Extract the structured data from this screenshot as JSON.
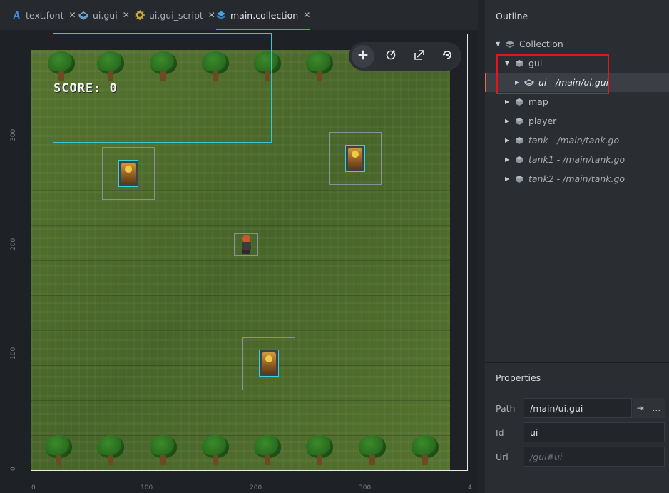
{
  "tabs": [
    {
      "label": "text.font",
      "icon": "font-icon",
      "active": false
    },
    {
      "label": "ui.gui",
      "icon": "gui-icon",
      "active": false
    },
    {
      "label": "ui.gui_script",
      "icon": "script-gear-icon",
      "active": false
    },
    {
      "label": "main.collection",
      "icon": "collection-icon",
      "active": true
    }
  ],
  "tab_close_glyph": "✕",
  "scene": {
    "score_text": "SCORE: 0",
    "ruler_vertical": [
      "300",
      "200",
      "100",
      "0"
    ],
    "ruler_horizontal": [
      "0",
      "100",
      "200",
      "300",
      "4"
    ]
  },
  "toolbar": {
    "tools": [
      "move-tool-icon",
      "rotate-tool-icon",
      "scale-tool-icon",
      "camera-reset-icon"
    ]
  },
  "outline": {
    "title": "Outline",
    "root": "Collection",
    "items": [
      {
        "label": "gui",
        "indent": 1,
        "expanded": true,
        "italic": false
      },
      {
        "label": "ui - /main/ui.gui",
        "indent": 2,
        "expanded": false,
        "italic": true,
        "selected": true
      },
      {
        "label": "map",
        "indent": 1,
        "expanded": false,
        "italic": false
      },
      {
        "label": "player",
        "indent": 1,
        "expanded": false,
        "italic": false
      },
      {
        "label": "tank - /main/tank.go",
        "indent": 1,
        "expanded": false,
        "italic": true
      },
      {
        "label": "tank1 - /main/tank.go",
        "indent": 1,
        "expanded": false,
        "italic": true
      },
      {
        "label": "tank2 - /main/tank.go",
        "indent": 1,
        "expanded": false,
        "italic": true
      }
    ]
  },
  "properties": {
    "title": "Properties",
    "path_label": "Path",
    "path_value": "/main/ui.gui",
    "path_goto_glyph": "⇥",
    "path_more_glyph": "…",
    "id_label": "Id",
    "id_value": "ui",
    "url_label": "Url",
    "url_value": "/gui#ui"
  },
  "colors": {
    "accent": "#e06c4a",
    "highlight_box": "#e8141b",
    "gui_bounds": "#35c9d0"
  }
}
